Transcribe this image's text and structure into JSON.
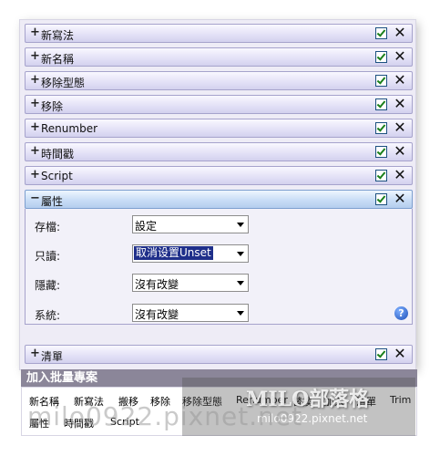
{
  "rows": [
    {
      "sign": "+",
      "title": "新寫法"
    },
    {
      "sign": "+",
      "title": "新名稱"
    },
    {
      "sign": "+",
      "title": "移除型態"
    },
    {
      "sign": "+",
      "title": "移除"
    },
    {
      "sign": "+",
      "title": "Renumber"
    },
    {
      "sign": "+",
      "title": "時間戳"
    },
    {
      "sign": "+",
      "title": "Script"
    },
    {
      "sign": "−",
      "title": "屬性"
    },
    {
      "sign": "+",
      "title": "清單"
    }
  ],
  "close_glyph": "✕",
  "properties": [
    {
      "label": "存檔:",
      "value": "設定"
    },
    {
      "label": "只讀:",
      "value": "取消设置Unset"
    },
    {
      "label": "隱藏:",
      "value": "沒有改變"
    },
    {
      "label": "系統:",
      "value": "沒有改變"
    }
  ],
  "help_glyph": "?",
  "add_batch": {
    "title": "加入批量專案",
    "tags_line1": [
      "新名稱",
      "新寫法",
      "搬移",
      "移除",
      "移除型態",
      "Renumber",
      "替換",
      "加入",
      "清單",
      "Trim"
    ],
    "tags_line2": [
      "屬性",
      "時間戳",
      "Script"
    ]
  },
  "watermark": {
    "brand": "MILO部落格",
    "url": "milo0922.pixnet.net",
    "url_large": "milo0922.pixnet.net"
  },
  "colors": {
    "row_border": "#a6a3cc",
    "expanded_row": "#b4cdee",
    "selection": "#1f2f8a",
    "header_bg": "#8b8699"
  }
}
